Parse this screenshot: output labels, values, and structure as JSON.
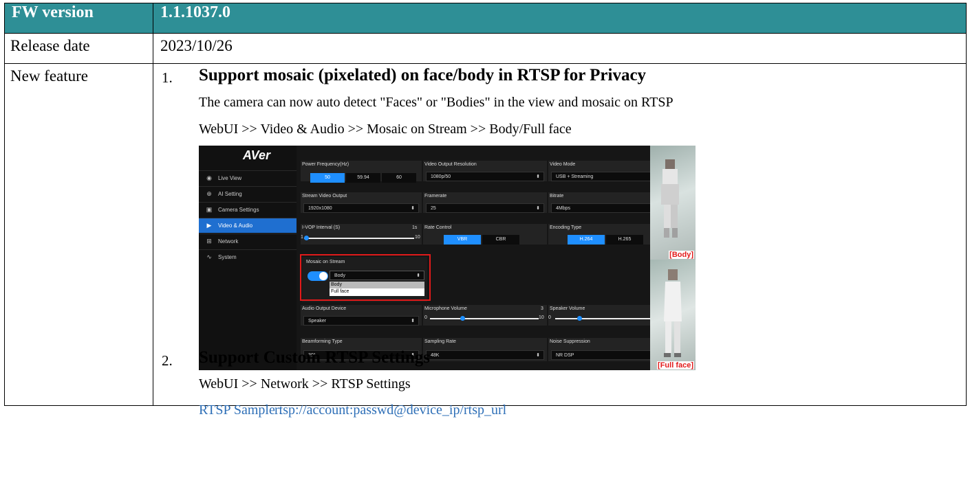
{
  "header": {
    "label": "FW version",
    "value": "1.1.1037.0"
  },
  "release": {
    "label": "Release date",
    "value": "2023/10/26"
  },
  "features": {
    "label": "New feature",
    "f1": {
      "num": "1.",
      "title": "Support mosaic (pixelated) on face/body in RTSP for Privacy",
      "desc": "The camera can now auto detect \"Faces\" or \"Bodies\" in the view and mosaic on RTSP",
      "path": "WebUI >> Video & Audio >> Mosaic on Stream >> Body/Full face"
    },
    "f2": {
      "num": "2.",
      "title": "Support Custom RTSP Settings",
      "path": "WebUI >> Network >> RTSP Settings",
      "sample_label": "RTSP Sample :",
      "sample_url": "rtsp://account:passwd@device_ip/rtsp_url"
    }
  },
  "shot": {
    "logo": "AVer",
    "nav": [
      "Live View",
      "AI Setting",
      "Camera Settings",
      "Video & Audio",
      "Network",
      "System"
    ],
    "nav_active": "Video & Audio",
    "power_freq": {
      "label": "Power Frequency(Hz)",
      "options": [
        "50",
        "59.94",
        "60"
      ],
      "selected": "50"
    },
    "video_out_res": {
      "label": "Video Output Resolution",
      "value": "1080p/50"
    },
    "video_mode": {
      "label": "Video Mode",
      "value": "USB + Streaming"
    },
    "stream_out": {
      "label": "Stream Video Output",
      "value": "1920x1080"
    },
    "framerate": {
      "label": "Framerate",
      "value": "25"
    },
    "bitrate": {
      "label": "Bitrate",
      "value": "4Mbps"
    },
    "ivop": {
      "label": "I-VOP Interval (S)",
      "value": "1s",
      "min": "1",
      "max": "10",
      "level": 1
    },
    "rate_control": {
      "label": "Rate Control",
      "options": [
        "VBR",
        "CBR"
      ],
      "selected": "VBR"
    },
    "encoding": {
      "label": "Encoding Type",
      "options": [
        "H.264",
        "H.265"
      ],
      "selected": "H.264"
    },
    "mosaic": {
      "label": "Mosaic on Stream",
      "value": "Body",
      "options": [
        "Body",
        "Full face"
      ]
    },
    "audio_out": {
      "label": "Audio Output Device",
      "value": "Speaker"
    },
    "mic": {
      "label": "Microphone Volume",
      "value": "3",
      "min": "0",
      "max": "10"
    },
    "speaker": {
      "label": "Speaker Volume",
      "value": "2",
      "min": "0",
      "max": "10"
    },
    "beam": {
      "label": "Beamforming Type",
      "value": "30°"
    },
    "sampling": {
      "label": "Sampling Rate",
      "value": "48K"
    },
    "noise": {
      "label": "Noise Suppression",
      "value": "NR DSP"
    },
    "tag_body": "[Body]",
    "tag_face": "[Full face]",
    "colors": {
      "accent": "#1f8fff",
      "header": "#2e8f96",
      "red": "#e21a1a"
    }
  }
}
